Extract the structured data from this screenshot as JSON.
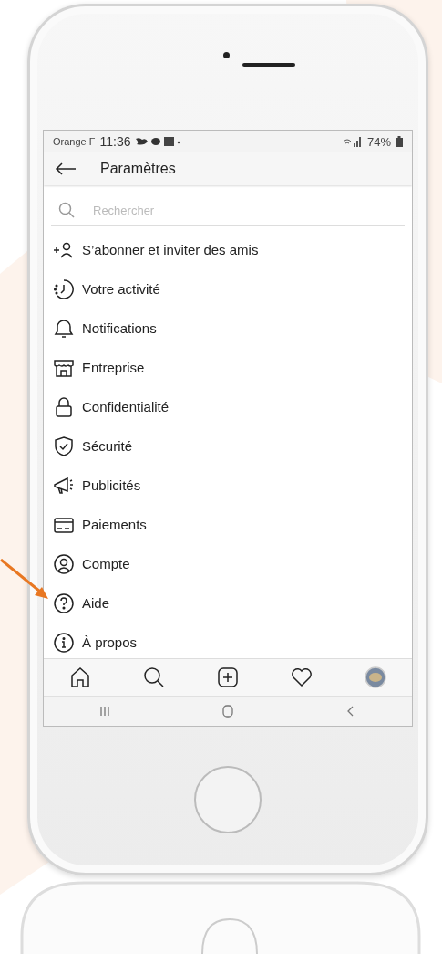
{
  "status_bar": {
    "carrier": "Orange F",
    "time": "11:36",
    "battery": "74%"
  },
  "header": {
    "title": "Paramètres"
  },
  "search": {
    "placeholder": "Rechercher"
  },
  "menu": [
    {
      "kind": "follow",
      "label": "S’abonner et inviter des amis"
    },
    {
      "kind": "activity",
      "label": "Votre activité"
    },
    {
      "kind": "bell",
      "label": "Notifications"
    },
    {
      "kind": "shop",
      "label": "Entreprise"
    },
    {
      "kind": "lock",
      "label": "Confidentialité"
    },
    {
      "kind": "shield",
      "label": "Sécurité"
    },
    {
      "kind": "megaphone",
      "label": "Publicités"
    },
    {
      "kind": "card",
      "label": "Paiements"
    },
    {
      "kind": "account",
      "label": "Compte"
    },
    {
      "kind": "help",
      "label": "Aide"
    },
    {
      "kind": "info",
      "label": "À propos"
    }
  ],
  "bottom_nav": [
    {
      "kind": "home"
    },
    {
      "kind": "search"
    },
    {
      "kind": "add"
    },
    {
      "kind": "heart"
    },
    {
      "kind": "avatar"
    }
  ],
  "system_nav": [
    {
      "kind": "recents"
    },
    {
      "kind": "home"
    },
    {
      "kind": "back"
    }
  ]
}
